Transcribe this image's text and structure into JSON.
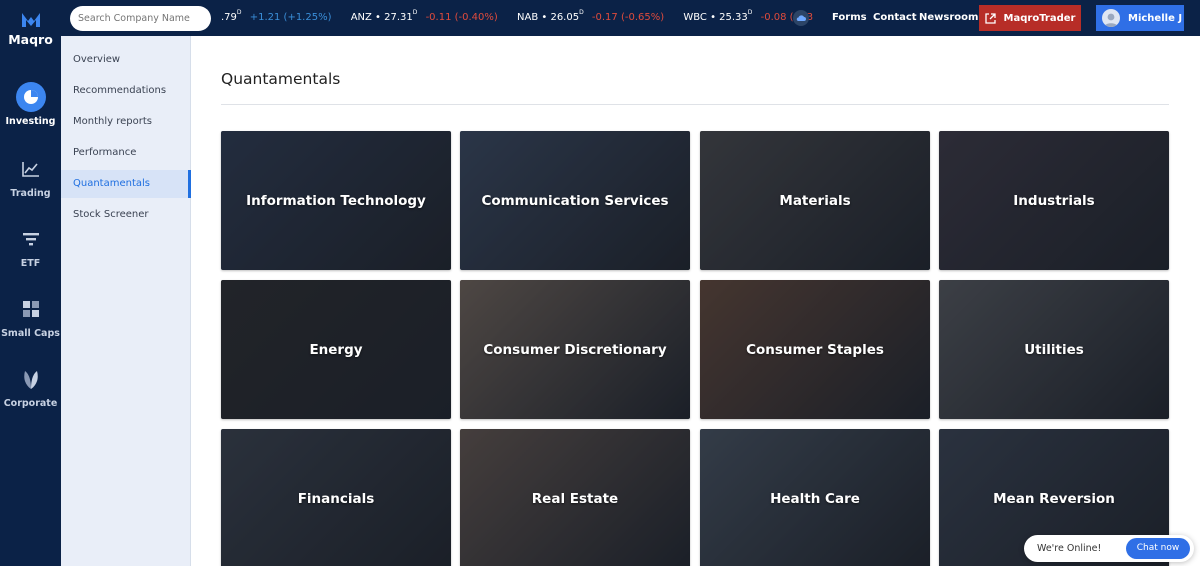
{
  "brand": {
    "name": "Maqro"
  },
  "rail": {
    "items": [
      {
        "label": "Investing",
        "icon": "pie-chart-icon",
        "active": true
      },
      {
        "label": "Trading",
        "icon": "line-chart-icon"
      },
      {
        "label": "ETF",
        "icon": "funnel-icon"
      },
      {
        "label": "Small Caps",
        "icon": "grid-icon"
      },
      {
        "label": "Corporate",
        "icon": "leaf-icon"
      }
    ]
  },
  "subnav": {
    "items": [
      {
        "label": "Overview"
      },
      {
        "label": "Recommendations"
      },
      {
        "label": "Monthly reports"
      },
      {
        "label": "Performance"
      },
      {
        "label": "Quantamentals",
        "active": true
      },
      {
        "label": "Stock Screener"
      }
    ]
  },
  "search": {
    "placeholder": "Search Company Name"
  },
  "ticker": [
    {
      "symbol": "",
      "price": ".79",
      "sup": "D",
      "change": "+1.21 (+1.25%)",
      "direction": "up"
    },
    {
      "symbol": "ANZ",
      "price": "27.31",
      "sup": "D",
      "change": "-0.11 (-0.40%)",
      "direction": "down"
    },
    {
      "symbol": "NAB",
      "price": "26.05",
      "sup": "D",
      "change": "-0.17 (-0.65%)",
      "direction": "down"
    },
    {
      "symbol": "WBC",
      "price": "25.33",
      "sup": "D",
      "change": "-0.08 (-0.3",
      "direction": "down"
    }
  ],
  "toplinks": {
    "forms": "Forms",
    "contact": "Contact",
    "newsroom": "Newsroom"
  },
  "trader_button": "MaqroTrader",
  "user": {
    "name": "Michelle J"
  },
  "page": {
    "title": "Quantamentals"
  },
  "cards": [
    {
      "label": "Information Technology",
      "theme": "#2c3a55"
    },
    {
      "label": "Communication Services",
      "theme": "#3a4a66"
    },
    {
      "label": "Materials",
      "theme": "#4a4a4e"
    },
    {
      "label": "Industrials",
      "theme": "#3d3846"
    },
    {
      "label": "Energy",
      "theme": "#2a2a2e"
    },
    {
      "label": "Consumer Discretionary",
      "theme": "#7a6a5e"
    },
    {
      "label": "Consumer Staples",
      "theme": "#6a4a3a"
    },
    {
      "label": "Utilities",
      "theme": "#5a5c62"
    },
    {
      "label": "Financials",
      "theme": "#3a4250"
    },
    {
      "label": "Real Estate",
      "theme": "#6a5a52"
    },
    {
      "label": "Health Care",
      "theme": "#4a5666"
    },
    {
      "label": "Mean Reversion",
      "theme": "#3a4456"
    }
  ],
  "chat": {
    "status": "We're Online!",
    "button": "Chat now"
  },
  "colors": {
    "navy": "#0b2247",
    "accent": "#1f6fe0",
    "danger": "#b72d27",
    "negative": "#e04b3c"
  }
}
